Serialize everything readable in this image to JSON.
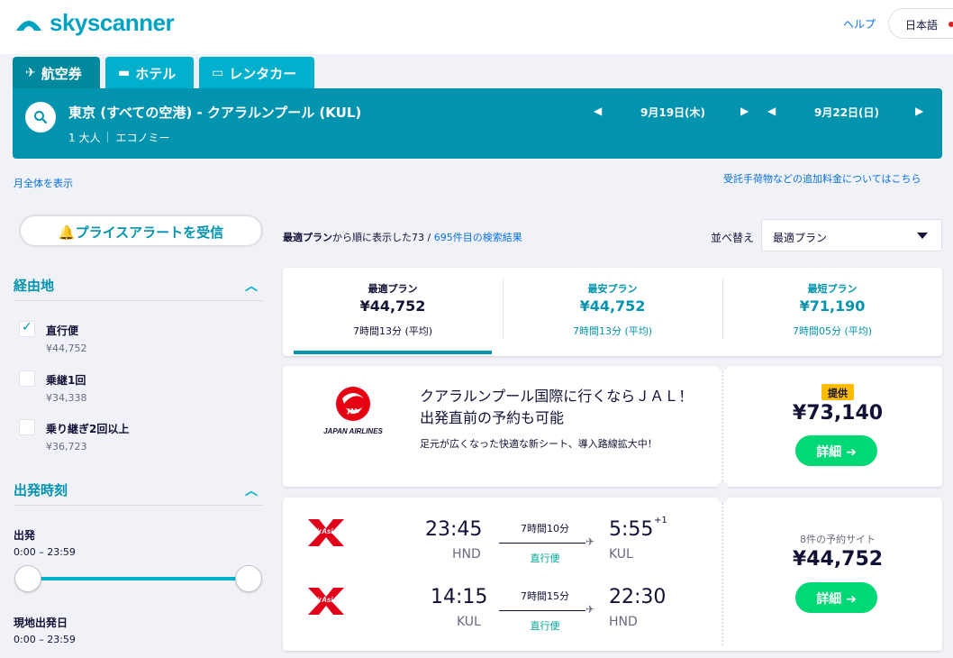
{
  "brand": {
    "name": "skyscanner",
    "color": "#00a2c2"
  },
  "header": {
    "help": "ヘルプ",
    "language": "日本語"
  },
  "tabs": [
    {
      "label": "航空券",
      "icon": "airplane-icon",
      "active": true
    },
    {
      "label": "ホテル",
      "icon": "bed-icon",
      "active": false
    },
    {
      "label": "レンタカー",
      "icon": "car-icon",
      "active": false
    }
  ],
  "search": {
    "route": "東京 (すべての空港) - クアラルンプール (KUL)",
    "passengers": "1 大人",
    "cabin": "エコノミー",
    "depart_date": "9月19日(木)",
    "return_date": "9月22日(日)"
  },
  "links": {
    "month_view": "月全体を表示",
    "extra_fees": "受託手荷物などの追加料金についてはこちら"
  },
  "price_alert": "プライスアラートを受信",
  "filters": {
    "stops_title": "経由地",
    "stops": [
      {
        "label": "直行便",
        "price": "¥44,752",
        "checked": true
      },
      {
        "label": "乗継1回",
        "price": "¥34,338",
        "checked": false
      },
      {
        "label": "乗り継ぎ2回以上",
        "price": "¥36,723",
        "checked": false
      }
    ],
    "times_title": "出発時刻",
    "departure_label": "出発",
    "departure_range": "0:00 – 23:59",
    "local_label": "現地出発日",
    "local_range": "0:00 – 23:59"
  },
  "results": {
    "prefix": "最適プラン",
    "middle": "から順に表示した73 / ",
    "total_link": "695件目の検索結果",
    "sort_label": "並べ替え",
    "sort_value": "最適プラン"
  },
  "summary": [
    {
      "label": "最適プラン",
      "price": "¥44,752",
      "duration": "7時間13分 (平均)",
      "selected": true
    },
    {
      "label": "最安プラン",
      "price": "¥44,752",
      "duration": "7時間13分 (平均)",
      "selected": false
    },
    {
      "label": "最短プラン",
      "price": "¥71,190",
      "duration": "7時間05分 (平均)",
      "selected": false
    }
  ],
  "ad": {
    "airline": "JAPAN AIRLINES",
    "logo_text": "JAL",
    "title_line1": "クアラルンプール国際に行くならＪＡＬ！",
    "title_line2": "出発直前の予約も可能",
    "subtitle": "足元が広くなった快適な新シート、導入路線拡大中！",
    "badge": "提供",
    "price": "¥73,140",
    "button": "詳細"
  },
  "flight": {
    "airline_logo_text": "AirAsia",
    "sites": "8件の予約サイト",
    "price": "¥44,752",
    "button": "詳細",
    "legs": [
      {
        "dep_time": "23:45",
        "dep_code": "HND",
        "duration": "7時間10分",
        "type": "直行便",
        "arr_time": "5:55",
        "arr_offset": "+1",
        "arr_code": "KUL"
      },
      {
        "dep_time": "14:15",
        "dep_code": "KUL",
        "duration": "7時間15分",
        "type": "直行便",
        "arr_time": "22:30",
        "arr_offset": "",
        "arr_code": "HND"
      }
    ]
  },
  "colors": {
    "accent": "#0293ae",
    "cta": "#00d775",
    "badge": "#ffbb00",
    "jal_red": "#e60012",
    "airasia_red": "#e10019"
  }
}
